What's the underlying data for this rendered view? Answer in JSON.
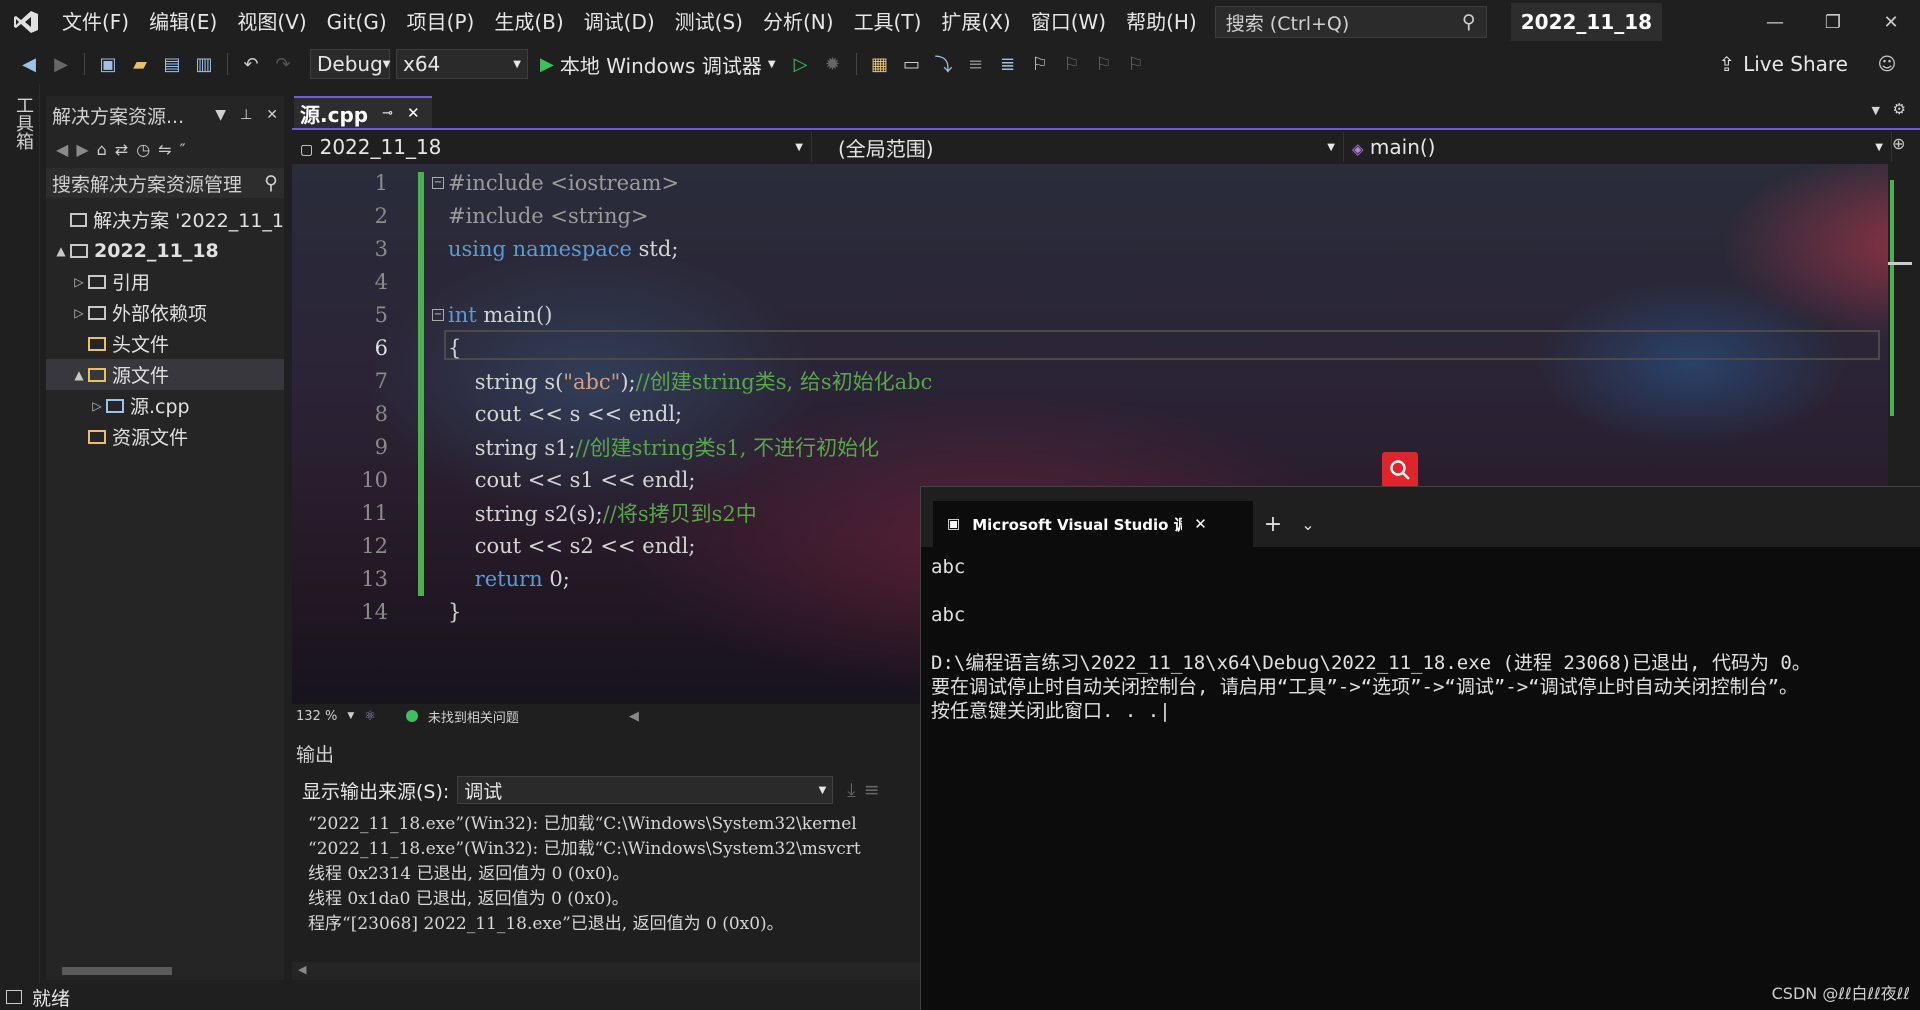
{
  "menu": {
    "items": [
      "文件(F)",
      "编辑(E)",
      "视图(V)",
      "Git(G)",
      "项目(P)",
      "生成(B)",
      "调试(D)",
      "测试(S)",
      "分析(N)",
      "工具(T)",
      "扩展(X)",
      "窗口(W)",
      "帮助(H)"
    ],
    "search_placeholder": "搜索 (Ctrl+Q)",
    "project_badge": "2022_11_18"
  },
  "toolbar": {
    "config": "Debug",
    "platform": "x64",
    "run_label": "本地 Windows 调试器",
    "live_share": "Live Share"
  },
  "toolbox": {
    "label": "工具箱"
  },
  "solution_explorer": {
    "title": "解决方案资源...",
    "search_placeholder": "搜索解决方案资源管理",
    "tree": [
      {
        "label": "解决方案 '2022_11_1",
        "indent": 0,
        "arrow": "",
        "bold": false
      },
      {
        "label": "2022_11_18",
        "indent": 0,
        "arrow": "▲",
        "bold": true
      },
      {
        "label": "引用",
        "indent": 1,
        "arrow": "▷",
        "bold": false
      },
      {
        "label": "外部依赖项",
        "indent": 1,
        "arrow": "▷",
        "bold": false
      },
      {
        "label": "头文件",
        "indent": 1,
        "arrow": "",
        "bold": false
      },
      {
        "label": "源文件",
        "indent": 1,
        "arrow": "▲",
        "bold": false,
        "selected": true
      },
      {
        "label": "源.cpp",
        "indent": 2,
        "arrow": "▷",
        "bold": false
      },
      {
        "label": "资源文件",
        "indent": 1,
        "arrow": "",
        "bold": false
      }
    ]
  },
  "editor": {
    "tab": "源.cpp",
    "nav_project": "2022_11_18",
    "nav_scope": "(全局范围)",
    "nav_member": "main()",
    "zoom": "132 %",
    "issues": "未找到相关问题",
    "lines": [
      {
        "n": "1",
        "html": "<span class='pp'>#include &lt;iostream&gt;</span>"
      },
      {
        "n": "2",
        "html": "<span class='pp'>#include &lt;string&gt;</span>"
      },
      {
        "n": "3",
        "html": "<span class='kw'>using namespace</span> std;"
      },
      {
        "n": "4",
        "html": ""
      },
      {
        "n": "5",
        "html": "<span class='kw'>int</span> main()"
      },
      {
        "n": "6",
        "html": "{"
      },
      {
        "n": "7",
        "html": "    string s(<span class='str'>\"abc\"</span>);<span class='cm'>//创建string类s, 给s初始化abc</span>"
      },
      {
        "n": "8",
        "html": "    cout &lt;&lt; s &lt;&lt; endl;"
      },
      {
        "n": "9",
        "html": "    string s1;<span class='cm'>//创建string类s1, 不进行初始化</span>"
      },
      {
        "n": "10",
        "html": "    cout &lt;&lt; s1 &lt;&lt; endl;"
      },
      {
        "n": "11",
        "html": "    string s2(s);<span class='cm'>//将s拷贝到s2中</span>"
      },
      {
        "n": "12",
        "html": "    cout &lt;&lt; s2 &lt;&lt; endl;"
      },
      {
        "n": "13",
        "html": "    <span class='kw'>return</span> 0;"
      },
      {
        "n": "14",
        "html": "}"
      }
    ]
  },
  "output": {
    "title": "输出",
    "source_label": "显示输出来源(S):",
    "source_value": "调试",
    "lines": [
      "“2022_11_18.exe”(Win32): 已加载“C:\\Windows\\System32\\kernel",
      "“2022_11_18.exe”(Win32): 已加载“C:\\Windows\\System32\\msvcrt",
      "线程 0x2314 已退出, 返回值为 0 (0x0)。",
      "线程 0x1da0 已退出, 返回值为 0 (0x0)。",
      "程序“[23068] 2022_11_18.exe”已退出, 返回值为 0 (0x0)。"
    ]
  },
  "statusbar": {
    "text": "就绪"
  },
  "console": {
    "tab_title": "Microsoft Visual Studio 调试控制台",
    "lines": [
      "abc",
      "",
      "abc",
      "",
      "D:\\编程语言练习\\2022_11_18\\x64\\Debug\\2022_11_18.exe (进程 23068)已退出, 代码为 0。",
      "要在调试停止时自动关闭控制台, 请启用“工具”->“选项”->“调试”->“调试停止时自动关闭控制台”。",
      "按任意键关闭此窗口. . ."
    ],
    "watermark": "CSDN @ℓℓ白ℓℓ夜ℓℓ"
  },
  "colors": {
    "accent": "#6c5fc7",
    "change_bar": "#4caf50",
    "keyword": "#569cd6",
    "comment": "#57a64a",
    "string": "#d69d85"
  }
}
